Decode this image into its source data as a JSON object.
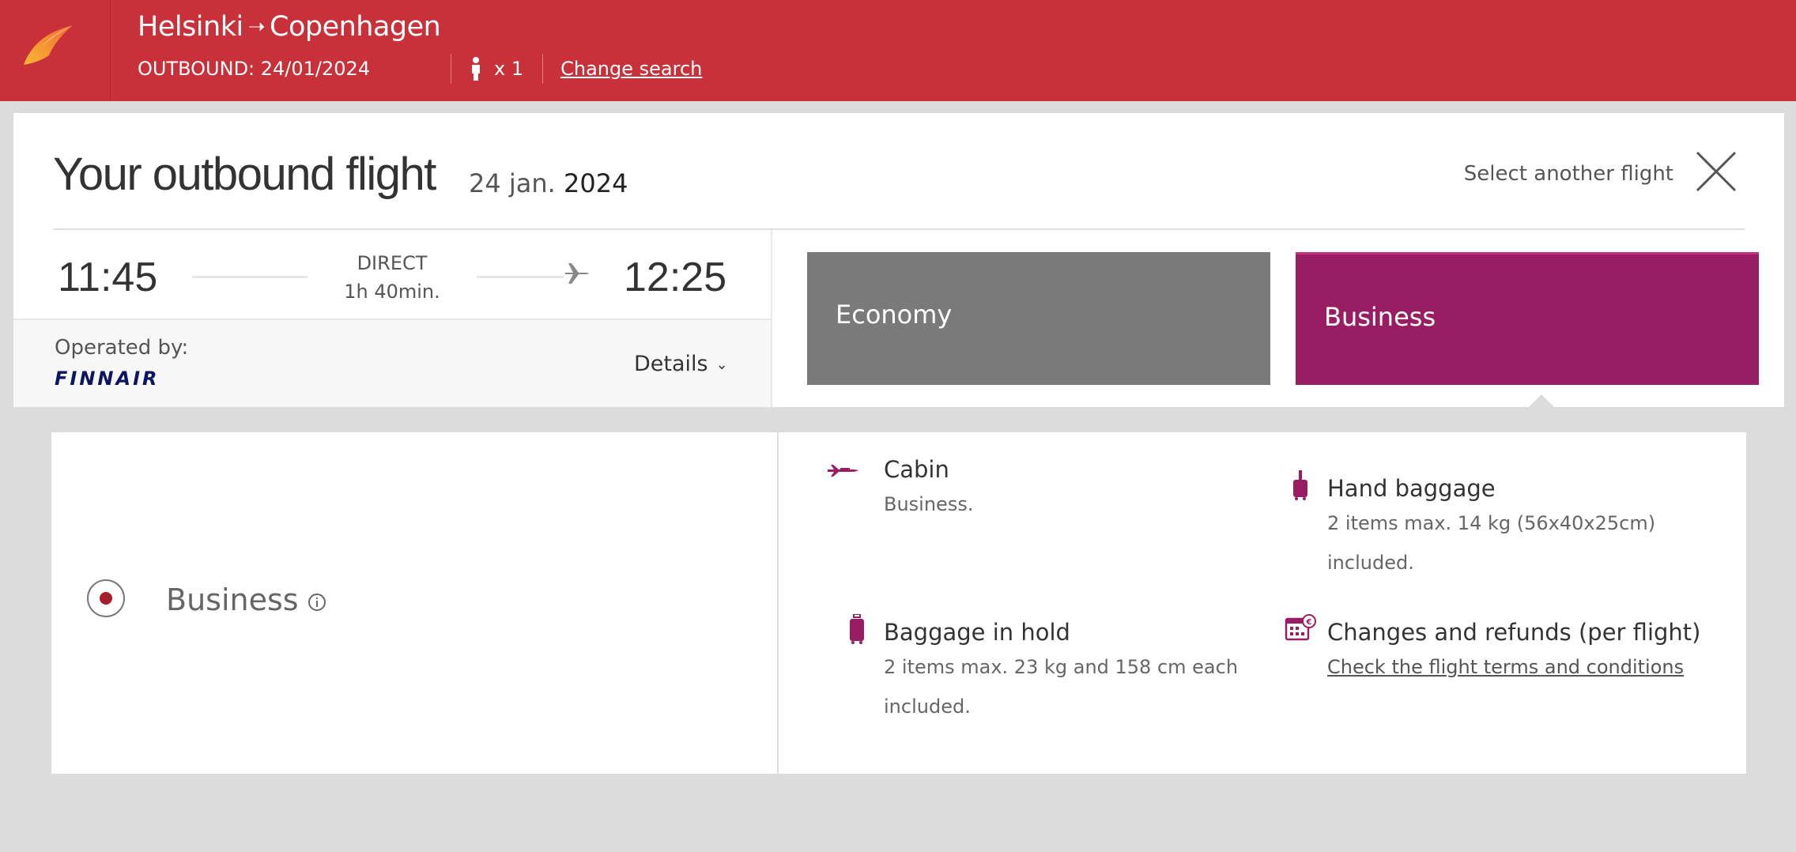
{
  "header": {
    "origin": "Helsinki",
    "destination": "Copenhagen",
    "arrow": "➝",
    "outbound": "OUTBOUND: 24/01/2024",
    "passengers": "x 1",
    "change_search": "Change search"
  },
  "panel": {
    "title": "Your outbound flight",
    "date_day": "24 jan.",
    "date_year": "2024",
    "select_another": "Select another flight"
  },
  "flight": {
    "departure": "11:45",
    "arrival": "12:25",
    "type": "DIRECT",
    "duration": "1h 40min.",
    "operated_by_label": "Operated by:",
    "operator": "FINNAIR",
    "details_label": "Details"
  },
  "fares": [
    {
      "label": "Economy",
      "color": "#7a7a7a"
    },
    {
      "label": "Business",
      "color": "#991d62"
    }
  ],
  "selected_option": {
    "label": "Business"
  },
  "features": {
    "cabin": {
      "title": "Cabin",
      "text": "Business."
    },
    "hand_baggage": {
      "title": "Hand baggage",
      "line1": "2 items max. 14 kg (56x40x25cm)",
      "line2": "included."
    },
    "hold_baggage": {
      "title": "Baggage in hold",
      "line1": "2 items max. 23 kg and 158 cm each",
      "line2": "included."
    },
    "changes": {
      "title": "Changes and refunds (per flight)",
      "link": "Check the flight terms and conditions"
    }
  },
  "colors": {
    "header_red": "#c8313a",
    "business_purple": "#991d62",
    "economy_grey": "#7a7a7a"
  }
}
